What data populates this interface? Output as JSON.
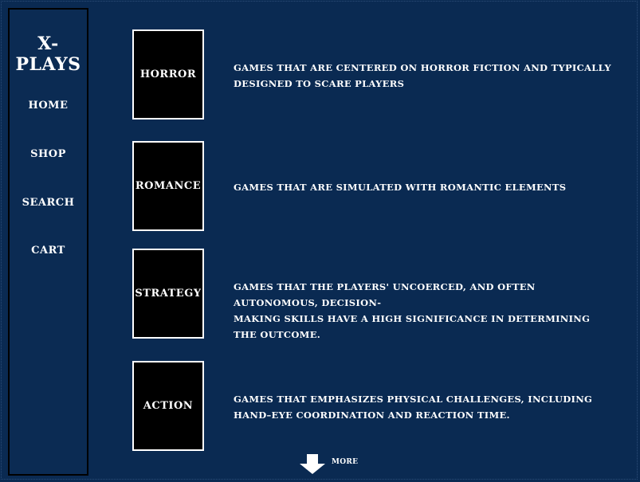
{
  "brand": "X-PLAYS",
  "nav": [
    {
      "label": "HOME"
    },
    {
      "label": "SHOP"
    },
    {
      "label": "SEARCH"
    },
    {
      "label": "CART"
    }
  ],
  "genres": [
    {
      "label": "HORROR",
      "description": "GAMES THAT ARE CENTERED ON HORROR FICTION AND TYPICALLY\nDESIGNED TO SCARE PLAYERS"
    },
    {
      "label": "ROMANCE",
      "description": "GAMES THAT ARE SIMULATED WITH ROMANTIC ELEMENTS"
    },
    {
      "label": "STRATEGY",
      "description": "GAMES THAT  THE PLAYERS' UNCOERCED, AND OFTEN AUTONOMOUS, DECISION-\nMAKING SKILLS HAVE A HIGH SIGNIFICANCE IN DETERMINING THE OUTCOME."
    },
    {
      "label": "ACTION",
      "description": "GAMES THAT  EMPHASIZES PHYSICAL CHALLENGES, INCLUDING\nHAND–EYE COORDINATION AND REACTION TIME."
    }
  ],
  "more": {
    "label": "MORE",
    "icon": "arrow-down-icon"
  },
  "colors": {
    "background": "#0a2a52",
    "card": "#000000",
    "text": "#ffffff"
  }
}
